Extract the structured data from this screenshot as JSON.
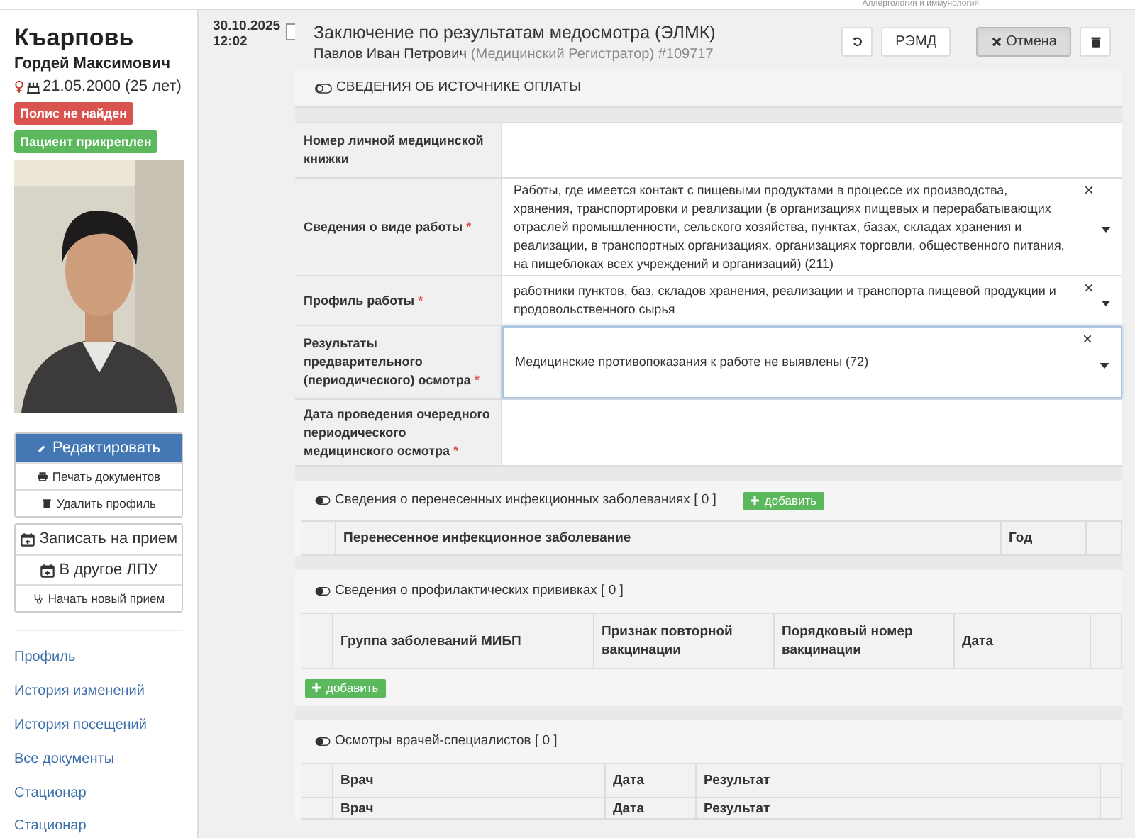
{
  "top_bar": {
    "text": "Аллергология и иммунология"
  },
  "patient": {
    "surname": "Къарповь",
    "name": "Гордей Максимович",
    "birth": "21.05.2000 (25 лет)",
    "badges": [
      {
        "label": "Полис не найден",
        "kind": "danger"
      },
      {
        "label": "Пациент прикреплен",
        "kind": "success"
      }
    ]
  },
  "actions": [
    {
      "label": "Редактировать",
      "kind": "primary"
    },
    {
      "label": "Печать документов",
      "kind": "small"
    },
    {
      "label": "Удалить профиль",
      "kind": "small"
    }
  ],
  "appointments": [
    {
      "label": "Записать на прием",
      "kind": "large"
    },
    {
      "label": "В другое ЛПУ",
      "kind": "large"
    },
    {
      "label": "Начать новый прием",
      "kind": "small"
    }
  ],
  "nav": [
    "Профиль",
    "История изменений",
    "История посещений",
    "Все документы",
    "Стационар",
    "Стационар"
  ],
  "document": {
    "date": "30.10.2025",
    "time": "12:02",
    "title": "Заключение по результатам медосмотра (ЭЛМК)",
    "author": "Павлов Иван Петрович",
    "role": "(Медицинский Регистратор) #109717",
    "buttons": [
      {
        "kind": "icon",
        "pressed": false
      },
      {
        "kind": "text",
        "label": "РЭМД",
        "pressed": false
      },
      {
        "kind": "text",
        "label": "Отмена",
        "pressed": true
      },
      {
        "kind": "icon",
        "pressed": false
      }
    ]
  },
  "payment_section": {
    "title": "СВЕДЕНИЯ ОБ ИСТОЧНИКЕ ОПЛАТЫ"
  },
  "fields": [
    {
      "label": "Номер личной медицинской книжки",
      "kind": "text",
      "focused": false
    },
    {
      "label": "Сведения о виде работы",
      "required_mark": "*",
      "kind": "select",
      "clear": "×",
      "focused": false,
      "value": "Работы, где имеется контакт с пищевыми продуктами в процессе их производства, хранения, транспортировки и реализации (в организациях пищевых и перерабатывающих отраслей промышленности, сельского хозяйства, пунктах, базах, складах хранения и реализации, в транспортных организациях, организациях торговли, общественного питания, на пищеблоках всех учреждений и организаций) (211)"
    },
    {
      "label": "Профиль работы",
      "required_mark": "*",
      "kind": "select",
      "clear": "×",
      "focused": false,
      "value": "работники пунктов, баз, складов хранения, реализации и транспорта пищевой продукции и продовольственного сырья"
    },
    {
      "label": "Результаты предварительного (периодического) осмотра",
      "required_mark": "*",
      "kind": "select",
      "clear": "×",
      "focused": true,
      "value": "Медицинские противопоказания к работе не выявлены (72)"
    },
    {
      "label": "Дата проведения очередного периодического медицинского осмотра",
      "required_mark": "*",
      "kind": "text",
      "focused": false
    }
  ],
  "subsections": [
    {
      "title": "Сведения о перенесенных инфекционных заболеваниях [ 0 ]",
      "kind": "header_add",
      "add_label": "добавить",
      "columns": [
        "Перенесенное инфекционное заболевание",
        "Год"
      ]
    },
    {
      "title": "Сведения о профилактических прививках [ 0 ]",
      "kind": "footer_add",
      "add_label": "добавить",
      "columns": [
        "Группа заболеваний МИБП",
        "Признак повторной вакцинации",
        "Порядковый номер вакцинации",
        "Дата"
      ]
    },
    {
      "title": "Осмотры врачей-специалистов [ 0 ]",
      "kind": "plain",
      "columns": [
        "Врач",
        "Дата",
        "Результат"
      ],
      "repeat_header": [
        "Врач",
        "Дата",
        "Результат"
      ]
    }
  ]
}
